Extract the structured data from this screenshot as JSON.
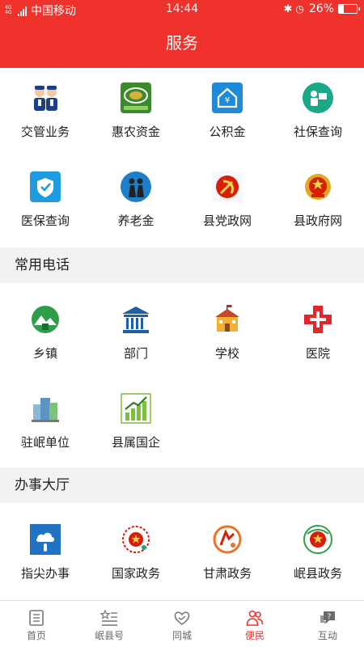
{
  "status_bar": {
    "network": "4G 4G",
    "carrier": "中国移动",
    "time": "14:44",
    "battery": "26%",
    "battery_level": 0.26
  },
  "header": {
    "title": "服务"
  },
  "services": [
    {
      "label": "交管业务",
      "icon": "traffic-police-icon"
    },
    {
      "label": "惠农资金",
      "icon": "farm-fund-icon"
    },
    {
      "label": "公积金",
      "icon": "housing-fund-icon"
    },
    {
      "label": "社保查询",
      "icon": "social-security-icon"
    },
    {
      "label": "医保查询",
      "icon": "medical-insurance-icon"
    },
    {
      "label": "养老金",
      "icon": "pension-icon"
    },
    {
      "label": "县党政网",
      "icon": "party-emblem-icon"
    },
    {
      "label": "县政府网",
      "icon": "national-emblem-icon"
    }
  ],
  "phone_section": {
    "title": "常用电话",
    "items": [
      {
        "label": "乡镇",
        "icon": "township-icon"
      },
      {
        "label": "部门",
        "icon": "department-building-icon"
      },
      {
        "label": "学校",
        "icon": "school-icon"
      },
      {
        "label": "医院",
        "icon": "hospital-cross-icon"
      },
      {
        "label": "驻岷单位",
        "icon": "office-buildings-icon"
      },
      {
        "label": "县属国企",
        "icon": "growth-chart-icon"
      }
    ]
  },
  "hall_section": {
    "title": "办事大厅",
    "items": [
      {
        "label": "指尖办事",
        "icon": "cloud-hand-icon"
      },
      {
        "label": "国家政务",
        "icon": "national-service-icon"
      },
      {
        "label": "甘肃政务",
        "icon": "gansu-service-icon"
      },
      {
        "label": "岷县政务",
        "icon": "minxian-service-icon"
      }
    ]
  },
  "tabbar": {
    "active_index": 3,
    "tabs": [
      {
        "label": "首页",
        "icon": "home-icon"
      },
      {
        "label": "岷县号",
        "icon": "star-list-icon"
      },
      {
        "label": "同城",
        "icon": "handshake-icon"
      },
      {
        "label": "便民",
        "icon": "people-icon"
      },
      {
        "label": "互动",
        "icon": "chat-question-icon"
      }
    ]
  },
  "colors": {
    "brand": "#f0322c",
    "section_bg": "#f2f2f2",
    "text": "#222222",
    "tab_inactive": "#666666"
  }
}
